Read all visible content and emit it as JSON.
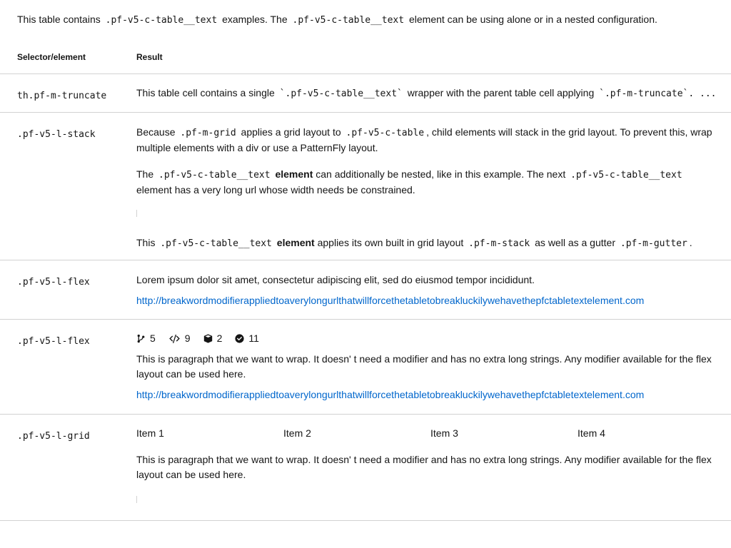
{
  "caption": {
    "t1": "This table contains",
    "code1": ".pf-v5-c-table__text",
    "t2": "examples. The",
    "code2": ".pf-v5-c-table__text",
    "t3": "element can be using alone or in a nested configuration."
  },
  "header": {
    "col1": "Selector/element",
    "col2": "Result"
  },
  "rows": [
    {
      "selector": "th.pf-m-truncate",
      "t1": "This table cell contains a single",
      "code1": "`.pf-v5-c-table__text`",
      "t2": "wrapper with the parent table cell applying",
      "code2": "`.pf-m-truncate`. ..."
    },
    {
      "selector": ".pf-v5-l-stack",
      "p1": {
        "t1": "Because",
        "code1": ".pf-m-grid",
        "t2": "applies a grid layout to",
        "code2": ".pf-v5-c-table",
        "t3": ", child elements will stack in the grid layout. To prevent this, wrap multiple elements with a div or use a PatternFly layout."
      },
      "p2": {
        "t1": "The",
        "code1": ".pf-v5-c-table__text",
        "bold1": "element",
        "t2": "can additionally be nested, like in this example. The next",
        "code2": ".pf-v5-c-table__text",
        "t3": "element has a very long url whose width needs be constrained."
      },
      "p3": {
        "t1": "This",
        "code1": ".pf-v5-c-table__text",
        "bold1": "element",
        "t2": "applies its own built in grid layout",
        "code2": ".pf-m-stack",
        "t3": "as well as a gutter",
        "code3": ".pf-m-gutter",
        "t4": "."
      }
    },
    {
      "selector": ".pf-v5-l-flex",
      "text": "Lorem ipsum dolor sit amet, consectetur adipiscing elit, sed do eiusmod tempor incididunt.",
      "link": "http://breakwordmodifierappliedtoaverylongurlthatwillforcethetabletobreakluckilywehavethepfctabletextelement.com"
    },
    {
      "selector": ".pf-v5-l-flex",
      "stats": [
        {
          "icon": "code-branch-icon",
          "value": "5"
        },
        {
          "icon": "code-icon",
          "value": "9"
        },
        {
          "icon": "cube-icon",
          "value": "2"
        },
        {
          "icon": "check-circle-icon",
          "value": "11"
        }
      ],
      "text": "This is paragraph that we want to wrap. It doesn' t need a modifier and has no extra long strings. Any modifier available for the flex layout can be used here.",
      "link": "http://breakwordmodifierappliedtoaverylongurlthatwillforcethetabletobreakluckilywehavethepfctabletextelement.com"
    },
    {
      "selector": ".pf-v5-l-grid",
      "items": [
        "Item 1",
        "Item 2",
        "Item 3",
        "Item 4"
      ],
      "text": "This is paragraph that we want to wrap. It doesn' t need a modifier and has no extra long strings. Any modifier available for the flex layout can be used here."
    }
  ],
  "colors": {
    "link": "#0066cc",
    "border": "#d2d2d2",
    "text": "#151515"
  }
}
